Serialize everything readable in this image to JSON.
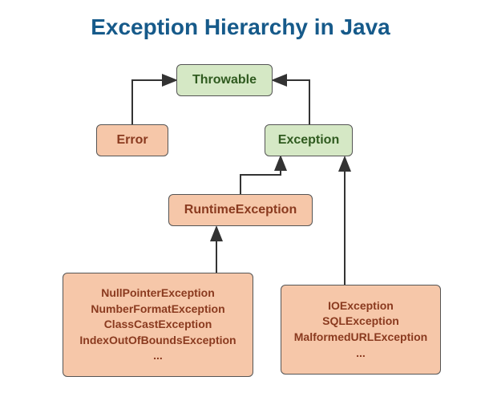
{
  "title": "Exception Hierarchy in Java",
  "nodes": {
    "throwable": "Throwable",
    "error": "Error",
    "exception": "Exception",
    "runtime": "RuntimeException",
    "runtime_list": {
      "l0": "NullPointerException",
      "l1": "NumberFormatException",
      "l2": "ClassCastException",
      "l3": "IndexOutOfBoundsException",
      "l4": "..."
    },
    "checked_list": {
      "l0": "IOException",
      "l1": "SQLException",
      "l2": "MalformedURLException",
      "l3": "..."
    }
  }
}
